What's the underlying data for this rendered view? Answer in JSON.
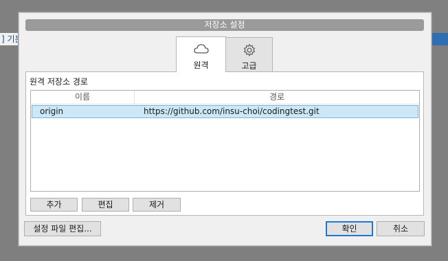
{
  "background": {
    "left_text": "] 기본"
  },
  "dialog": {
    "title": "저장소 설정",
    "tabs": [
      {
        "label": "원격",
        "icon": "cloud-icon",
        "active": true
      },
      {
        "label": "고급",
        "icon": "gear-icon",
        "active": false
      }
    ],
    "panel_title": "원격 저장소 경로",
    "table": {
      "columns": [
        "이름",
        "경로"
      ],
      "rows": [
        {
          "name": "origin",
          "path": "https://github.com/insu-choi/codingtest.git",
          "selected": true
        }
      ]
    },
    "buttons": {
      "add": "추가",
      "edit": "편집",
      "remove": "제거",
      "edit_config": "설정 파일 편집...",
      "ok": "확인",
      "cancel": "취소"
    }
  },
  "colors": {
    "selection": "#cce8f6",
    "title_bar": "#9a9a9a",
    "ok_border": "#1f78d1"
  }
}
